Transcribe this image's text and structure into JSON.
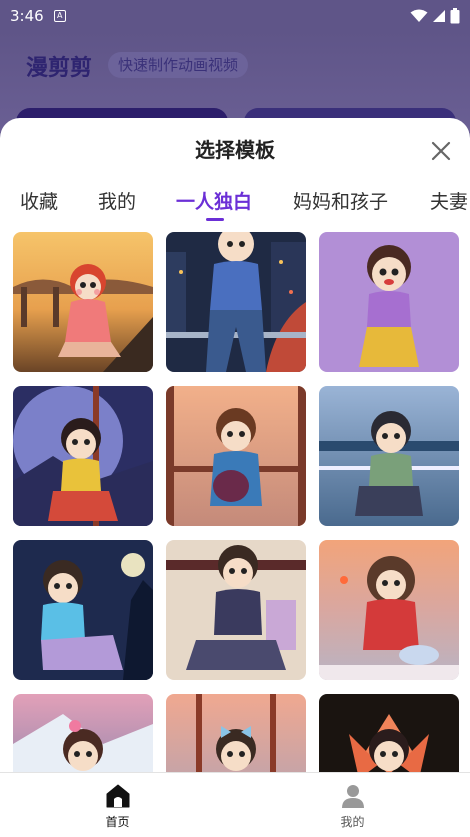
{
  "status_bar": {
    "time": "3:46",
    "sim_icon": "sim-a-icon"
  },
  "app": {
    "title": "漫剪剪",
    "tagline": "快速制作动画视频"
  },
  "sheet": {
    "title": "选择模板",
    "close_icon": "close-icon",
    "tabs": [
      {
        "label": "收藏"
      },
      {
        "label": "我的"
      },
      {
        "label": "一人独白",
        "active": true
      },
      {
        "label": "妈妈和孩子"
      },
      {
        "label": "夫妻"
      }
    ],
    "accent_color": "#6b2fd6"
  },
  "templates": [
    {
      "scene": "bridge-sunset-red-hair-girl"
    },
    {
      "scene": "city-night-boy-on-railing"
    },
    {
      "scene": "purple-wall-girl-sitting"
    },
    {
      "scene": "full-moon-girl-yellow-top"
    },
    {
      "scene": "window-sunset-boy-hugging"
    },
    {
      "scene": "lakeside-girl-green-shirt"
    },
    {
      "scene": "night-tree-girl-blue-top"
    },
    {
      "scene": "dark-room-girl-sitting-floor"
    },
    {
      "scene": "sunset-girl-red-dress-pillow"
    },
    {
      "scene": "snowy-mountain-girl-flower"
    },
    {
      "scene": "window-sea-girl-bow"
    },
    {
      "scene": "lotus-girl-dark"
    }
  ],
  "bottom_nav": [
    {
      "label": "首页",
      "icon": "home-icon",
      "active": true
    },
    {
      "label": "我的",
      "icon": "person-icon",
      "active": false
    }
  ]
}
